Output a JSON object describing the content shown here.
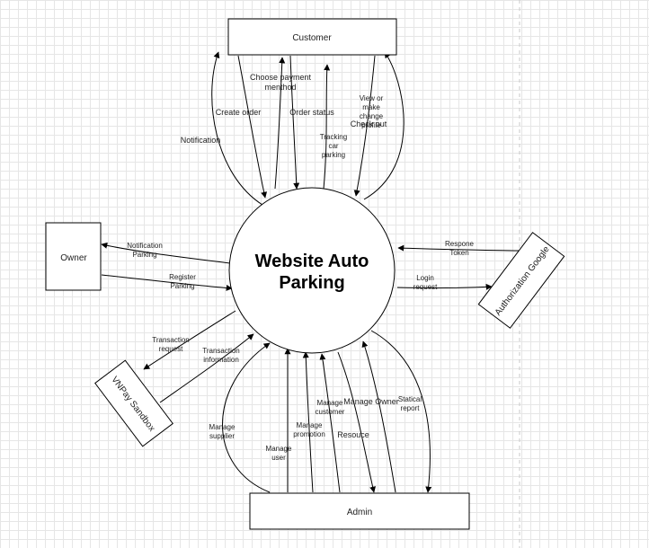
{
  "nodes": {
    "center": "Website Auto Parking",
    "customer": "Customer",
    "owner": "Owner",
    "google": "Authorization Google",
    "vnpay": "VNPay Sandbox",
    "admin": "Admin"
  },
  "flows": {
    "notification": "Notification",
    "create_order": "Create order",
    "choose_payment": "Choose payment menthod",
    "order_status": "Order status",
    "tracking": "Tracking car parking",
    "checkout": "Check out",
    "view_profile": "View or make change profile",
    "owner_notification": "Notification Parking",
    "register_parking": "Register Parking",
    "response_token": "Respone Token",
    "login_request": "Login request",
    "transaction_request": "Transaction request",
    "transaction_information": "Transaction information",
    "manage_supplier": "Manage supplier",
    "manage_user": "Manage user",
    "manage_promotion": "Manage promotion",
    "manage_customer": "Manage customer",
    "manage_owner": "Manage Owner",
    "resource": "Resouce",
    "statical_report": "Statical report"
  },
  "colors": {
    "grid": "#e6e6e6",
    "stroke": "#000000",
    "background": "#ffffff"
  }
}
